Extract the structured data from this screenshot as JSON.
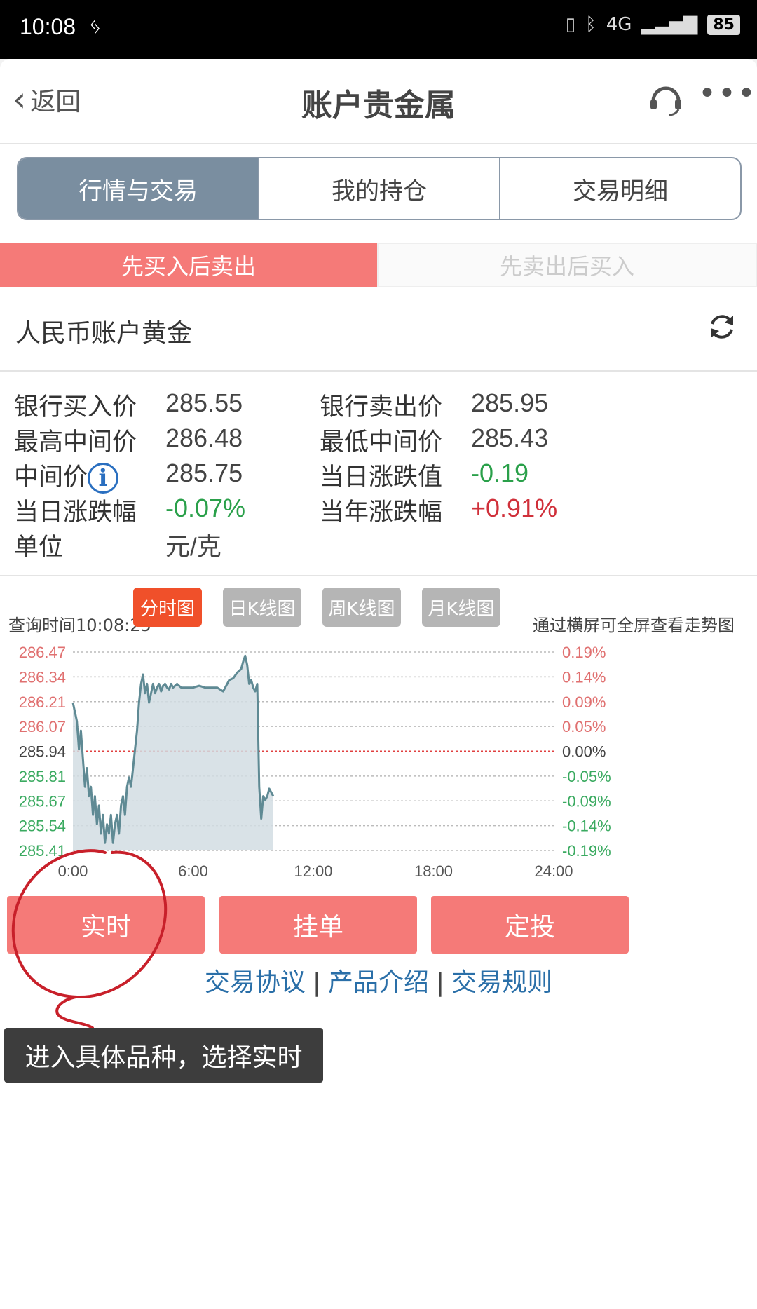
{
  "status_bar": {
    "time": "10:08",
    "battery": "85",
    "network": "4G"
  },
  "navbar": {
    "back_label": "返回",
    "title": "账户贵金属"
  },
  "segment_tabs": [
    "行情与交易",
    "我的持仓",
    "交易明细"
  ],
  "direction_tabs": [
    "先买入后卖出",
    "先卖出后买入"
  ],
  "product": {
    "name": "人民币账户黄金"
  },
  "prices": {
    "bank_buy_label": "银行买入价",
    "bank_buy": "285.55",
    "bank_sell_label": "银行卖出价",
    "bank_sell": "285.95",
    "high_mid_label": "最高中间价",
    "high_mid": "286.48",
    "low_mid_label": "最低中间价",
    "low_mid": "285.43",
    "mid_label": "中间价",
    "mid": "285.75",
    "day_change_label": "当日涨跌值",
    "day_change": "-0.19",
    "day_pct_label": "当日涨跌幅",
    "day_pct": "-0.07%",
    "year_pct_label": "当年涨跌幅",
    "year_pct": "+0.91%",
    "unit_label": "单位",
    "unit": "元/克"
  },
  "query_time": "查询时间10:08:25",
  "landscape_hint": "通过横屏可全屏查看走势图",
  "chart_tabs": [
    "分时图",
    "日K线图",
    "周K线图",
    "月K线图"
  ],
  "colors": {
    "accent_red": "#f57a78",
    "active_orange": "#f0502a",
    "tab_gray": "#b5b5b5",
    "up": "#d0303a",
    "down": "#2aa04a"
  },
  "chart_data": {
    "type": "area",
    "y_left_ticks": [
      "286.47",
      "286.34",
      "286.21",
      "286.07",
      "285.94",
      "285.81",
      "285.67",
      "285.54",
      "285.41"
    ],
    "y_right_ticks": [
      "0.19%",
      "0.14%",
      "0.09%",
      "0.05%",
      "0.00%",
      "-0.05%",
      "-0.09%",
      "-0.14%",
      "-0.19%"
    ],
    "x_ticks": [
      "0:00",
      "6:00",
      "12:00",
      "18:00",
      "24:00"
    ],
    "x_range": [
      0,
      24
    ],
    "ylim": [
      285.41,
      286.47
    ],
    "baseline": 285.94,
    "series": [
      {
        "x": [
          0,
          0.1,
          0.2,
          0.3,
          0.4,
          0.5,
          0.6,
          0.7,
          0.8,
          0.9,
          1.0,
          1.1,
          1.2,
          1.3,
          1.4,
          1.5,
          1.6,
          1.7,
          1.8,
          1.9,
          2.0,
          2.1,
          2.2,
          2.3,
          2.4,
          2.5,
          2.6,
          2.7,
          2.8,
          2.9,
          3.0,
          3.1,
          3.2,
          3.3,
          3.4,
          3.5,
          3.6,
          3.7,
          3.8,
          3.9,
          4.0,
          4.1,
          4.2,
          4.3,
          4.4,
          4.5,
          4.6,
          4.7,
          4.8,
          4.9,
          5.0,
          5.2,
          5.4,
          5.6,
          5.8,
          6.0,
          6.3,
          6.6,
          6.9,
          7.2,
          7.5,
          7.8,
          8.0,
          8.2,
          8.4,
          8.5,
          8.6,
          8.7,
          8.8,
          8.9,
          9.0,
          9.1,
          9.2,
          9.3,
          9.4,
          9.5,
          9.6,
          9.7,
          9.8,
          9.9,
          10.0
        ],
        "y": [
          286.2,
          286.15,
          286.1,
          285.95,
          286.05,
          285.9,
          285.75,
          285.85,
          285.7,
          285.75,
          285.6,
          285.7,
          285.55,
          285.65,
          285.5,
          285.6,
          285.45,
          285.55,
          285.5,
          285.6,
          285.45,
          285.55,
          285.6,
          285.5,
          285.65,
          285.7,
          285.6,
          285.75,
          285.8,
          285.75,
          285.85,
          285.95,
          286.05,
          286.2,
          286.3,
          286.35,
          286.25,
          286.3,
          286.2,
          286.25,
          286.3,
          286.25,
          286.28,
          286.3,
          286.26,
          286.29,
          286.3,
          286.28,
          286.27,
          286.3,
          286.28,
          286.3,
          286.28,
          286.28,
          286.28,
          286.28,
          286.29,
          286.28,
          286.28,
          286.28,
          286.26,
          286.32,
          286.33,
          286.36,
          286.38,
          286.42,
          286.45,
          286.4,
          286.3,
          286.32,
          286.28,
          286.26,
          286.3,
          285.75,
          285.58,
          285.7,
          285.68,
          285.7,
          285.74,
          285.72,
          285.7
        ]
      }
    ]
  },
  "action_buttons": [
    "实时",
    "挂单",
    "定投"
  ],
  "links": [
    "交易协议",
    "产品介绍",
    "交易规则"
  ],
  "annotation_text": "进入具体品种，选择实时"
}
